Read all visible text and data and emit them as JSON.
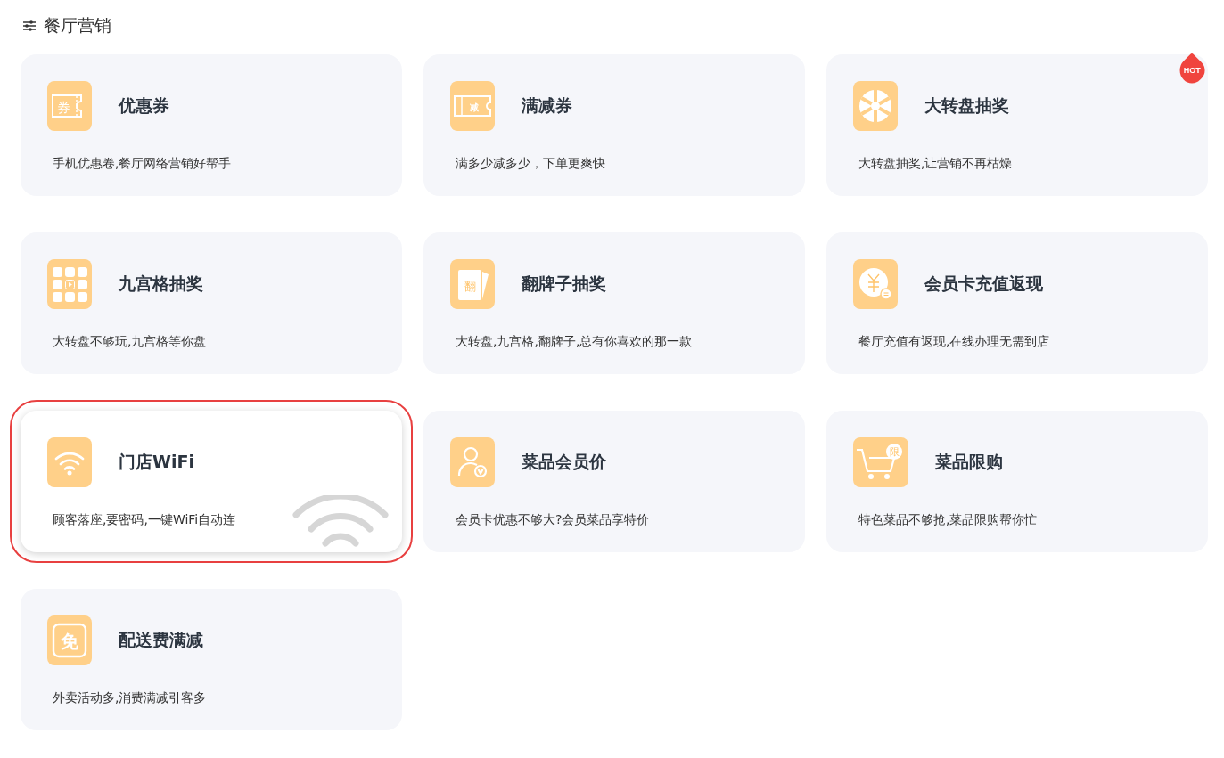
{
  "header": {
    "title": "餐厅营销"
  },
  "cards": [
    {
      "kind": "coupon",
      "glyph": "券",
      "title": "优惠券",
      "desc": "手机优惠卷,餐厅网络营销好帮手",
      "selected": false,
      "hot": false
    },
    {
      "kind": "ticket",
      "glyph": "减",
      "title": "满减券",
      "desc": "满多少减多少，下单更爽快",
      "selected": false,
      "hot": false
    },
    {
      "kind": "wheel",
      "title": "大转盘抽奖",
      "desc": "大转盘抽奖,让营销不再枯燥",
      "selected": false,
      "hot": true,
      "badge": "HOT"
    },
    {
      "kind": "grid",
      "title": "九宫格抽奖",
      "desc": "大转盘不够玩,九宫格等你盘",
      "selected": false,
      "hot": false
    },
    {
      "kind": "card",
      "glyph": "翻",
      "title": "翻牌子抽奖",
      "desc": "大转盘,九宫格,翻牌子,总有你喜欢的那一款",
      "selected": false,
      "hot": false
    },
    {
      "kind": "coin",
      "title": "会员卡充值返现",
      "desc": "餐厅充值有返现,在线办理无需到店",
      "selected": false,
      "hot": false
    },
    {
      "kind": "wifi",
      "title": "门店WiFi",
      "desc": "顾客落座,要密码,一键WiFi自动连",
      "selected": true,
      "hot": false
    },
    {
      "kind": "person",
      "title": "菜品会员价",
      "desc": "会员卡优惠不够大?会员菜品享特价",
      "selected": false,
      "hot": false
    },
    {
      "kind": "cart",
      "glyph": "限",
      "title": "菜品限购",
      "desc": "特色菜品不够抢,菜品限购帮你忙",
      "selected": false,
      "hot": false
    },
    {
      "kind": "free",
      "glyph": "免",
      "title": "配送费满减",
      "desc": "外卖活动多,消费满减引客多",
      "selected": false,
      "hot": false
    }
  ]
}
